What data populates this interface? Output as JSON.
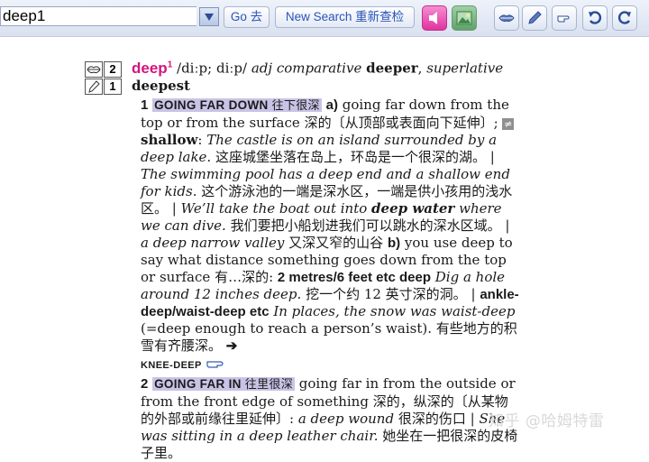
{
  "toolbar": {
    "search_value": "deep1",
    "go_label": "Go 去",
    "new_search_label": "New Search 重新查检",
    "icons": [
      "chevron-down-icon",
      "speaker-icon",
      "picture-icon",
      "lips-icon",
      "pencil-icon",
      "pointing-hand-icon",
      "back-icon",
      "refresh-icon"
    ]
  },
  "side": {
    "spoken_freq": "2",
    "written_freq": "1"
  },
  "entry": {
    "headword": "deep",
    "homonym": "1",
    "pron": "/diːp; diːp/",
    "pos": "adj",
    "comp_label": "comparative",
    "comparative": "deeper",
    "sup_label": "superlative",
    "superlative": "deepest",
    "sense1": {
      "num": "1",
      "signpost": "GOING FAR DOWN",
      "signpost_cn": "往下很深",
      "letter_a": "a)",
      "def_a": "going far down from the top or from the surface",
      "def_a_cn": "深的〔从顶部或表面向下延伸〕;",
      "opp_sym": "≠",
      "opp_word": "shallow",
      "ex1": "The castle is on an island surrounded by a deep lake.",
      "ex1_cn": "这座城堡坐落在岛上，环岛是一个很深的湖。",
      "sep": "|",
      "ex2": "The swimming pool has a deep end and a shallow end for kids.",
      "ex2_cn": "这个游泳池的一端是深水区，一端是供小孩用的浅水区。",
      "ex3a": "We’ll take the boat out into",
      "ex3_colloc": "deep water",
      "ex3b": "where we can dive.",
      "ex3_cn": "我们要把小船划进我们可以跳水的深水区域。",
      "ex4": "a deep narrow valley",
      "ex4_cn": "又深又窄的山谷",
      "letter_b": "b)",
      "def_b": "you use deep to say what distance something goes down from the top or surface",
      "def_b_cn": "有…深的:",
      "pattern1": "2 metres/6 feet etc deep",
      "ex5": "Dig a hole around 12 inches deep.",
      "ex5_cn": "挖一个约 12 英寸深的洞。",
      "pattern2": "ankle-deep/waist-deep etc",
      "ex6": "In places, the snow was waist-deep",
      "ex6_note": "(=deep enough to reach a person’s waist).",
      "ex6_cn": "有些地方的积雪有齐腰深。",
      "xref_arrow": "➔",
      "xref": "KNEE-DEEP"
    },
    "sense2": {
      "num": "2",
      "signpost": "GOING FAR IN",
      "signpost_cn": "往里很深",
      "def": "going far in from the outside or from the front edge of something",
      "def_cn": "深的，纵深的〔从某物的外部或前缘往里延伸〕:",
      "ex1": "a deep wound",
      "ex1_cn": "很深的伤口",
      "ex2": "She was sitting in a deep leather chair.",
      "ex2_cn": "她坐在一把很深的皮椅子里。"
    }
  },
  "watermark": "知乎 @哈姆特雷"
}
